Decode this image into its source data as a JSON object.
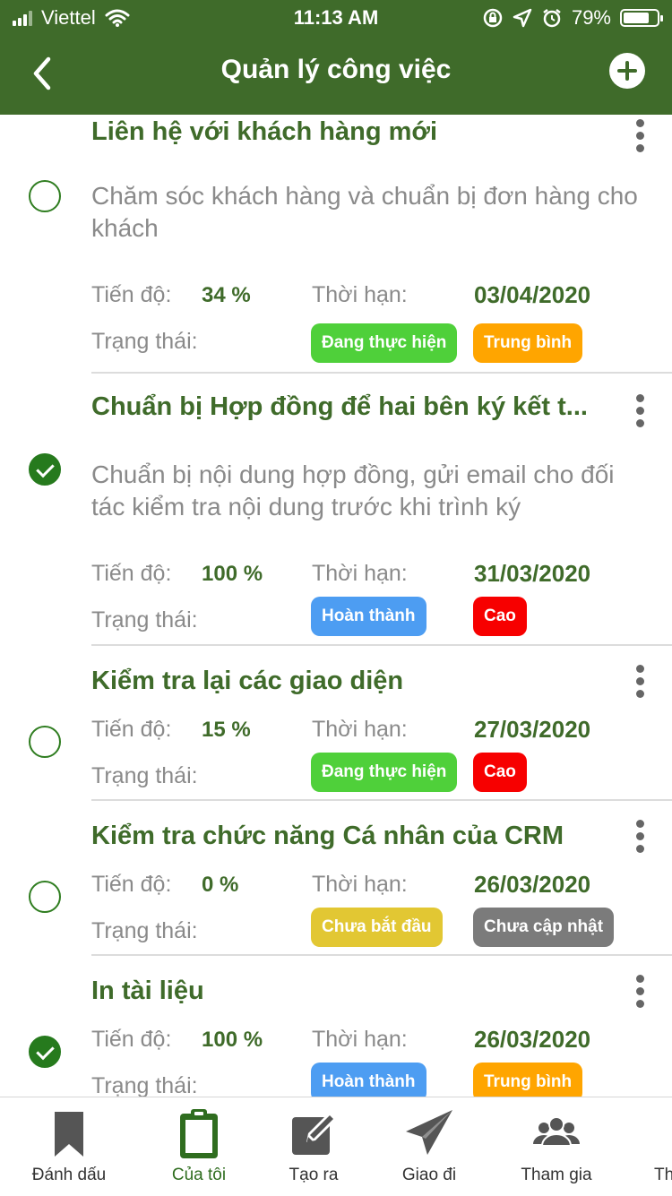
{
  "status_bar": {
    "carrier": "Viettel",
    "time": "11:13 AM",
    "battery": "79%",
    "battery_level": 0.79,
    "icons": [
      "signal-icon",
      "wifi-icon",
      "rotation-lock-icon",
      "location-icon",
      "alarm-icon",
      "battery-icon"
    ]
  },
  "header": {
    "title": "Quản lý công việc",
    "back_icon": "chevron-left-icon",
    "add_icon": "plus-circle-icon",
    "background": "#3f6b2a"
  },
  "labels": {
    "progress": "Tiến độ:",
    "deadline": "Thời hạn:",
    "status": "Trạng thái:"
  },
  "tasks": [
    {
      "title": "Liên hệ với khách hàng mới",
      "description": "Chăm sóc khách hàng và chuẩn bị đơn hàng cho khách",
      "progress": "34 %",
      "deadline": "03/04/2020",
      "status": "Đang thực hiện",
      "priority": "Trung bình",
      "completed": false
    },
    {
      "title": "Chuẩn bị Hợp đồng để hai bên ký kết t...",
      "description": "Chuẩn bị nội dung hợp đồng, gửi email cho đối tác kiểm tra nội dung trước khi trình ký",
      "progress": "100 %",
      "deadline": "31/03/2020",
      "status": "Hoàn thành",
      "priority": "Cao",
      "completed": true
    },
    {
      "title": "Kiểm tra lại các giao diện",
      "description": "",
      "progress": "15 %",
      "deadline": "27/03/2020",
      "status": "Đang thực hiện",
      "priority": "Cao",
      "completed": false
    },
    {
      "title": "Kiểm tra chức năng Cá nhân của CRM",
      "description": "",
      "progress": "0 %",
      "deadline": "26/03/2020",
      "status": "Chưa bắt đầu",
      "priority": "Chưa cập nhật",
      "completed": false
    },
    {
      "title": "In tài liệu",
      "description": "",
      "progress": "100 %",
      "deadline": "26/03/2020",
      "status": "Hoàn thành",
      "priority": "Trung bình",
      "completed": true
    }
  ],
  "badge_colors": {
    "Đang thực hiện": "#4fd03a",
    "Hoàn thành": "#4d9df2",
    "Chưa bắt đầu": "#e2c733",
    "Trung bình": "#ffa500",
    "Cao": "#f70000",
    "Chưa cập nhật": "#7b7b7b"
  },
  "tab_bar": {
    "items": [
      {
        "label": "Đánh dấu",
        "icon": "bookmark-icon",
        "active": false
      },
      {
        "label": "Của tôi",
        "icon": "clipboard-icon",
        "active": true
      },
      {
        "label": "Tạo ra",
        "icon": "edit-icon",
        "active": false
      },
      {
        "label": "Giao đi",
        "icon": "send-icon",
        "active": false
      },
      {
        "label": "Tham gia",
        "icon": "group-icon",
        "active": false
      },
      {
        "label": "Th",
        "icon": "",
        "active": false
      }
    ],
    "active_color": "#2f6d1f"
  }
}
